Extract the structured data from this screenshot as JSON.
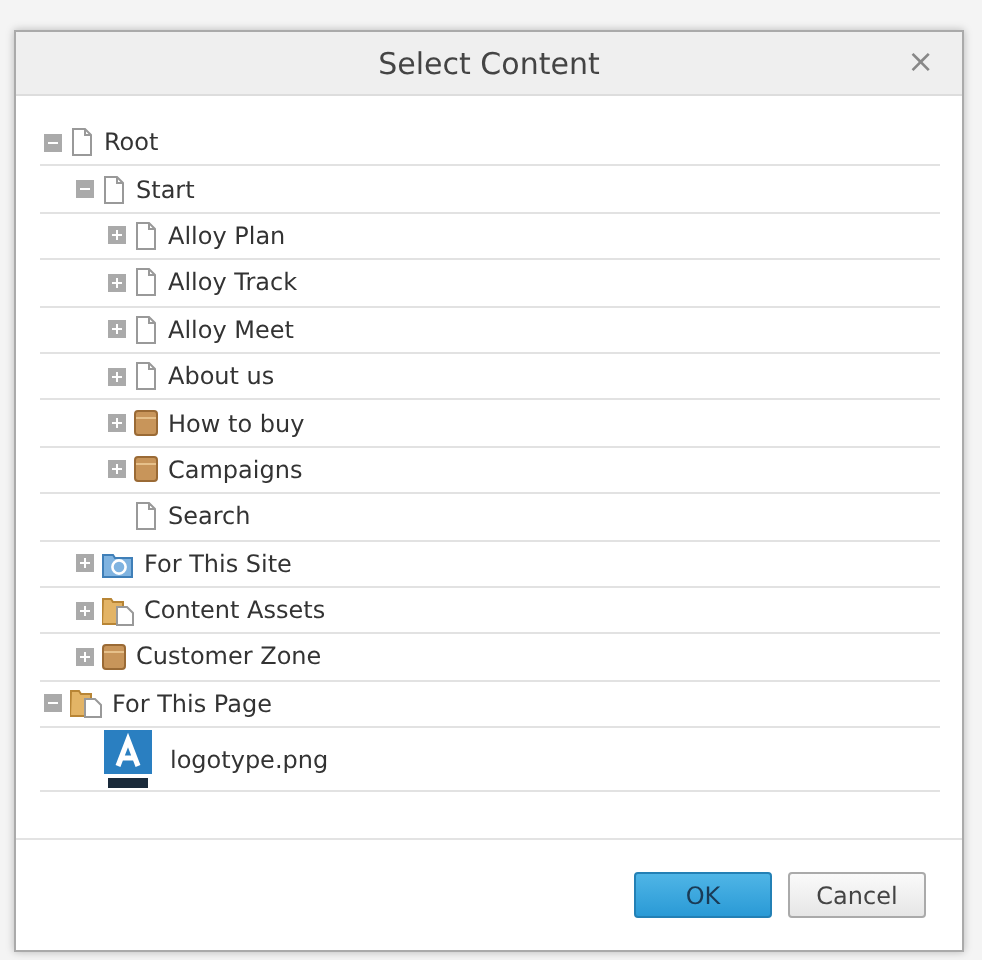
{
  "dialog": {
    "title": "Select Content",
    "close": "×"
  },
  "tree": [
    {
      "label": "Root",
      "kind": "page",
      "expanded": true,
      "children": [
        {
          "label": "Start",
          "kind": "page",
          "expanded": true,
          "children": [
            {
              "label": "Alloy Plan",
              "kind": "page",
              "expanded": false
            },
            {
              "label": "Alloy Track",
              "kind": "page",
              "expanded": false
            },
            {
              "label": "Alloy Meet",
              "kind": "page",
              "expanded": false
            },
            {
              "label": "About us",
              "kind": "page",
              "expanded": false
            },
            {
              "label": "How to buy",
              "kind": "box",
              "expanded": false
            },
            {
              "label": "Campaigns",
              "kind": "box",
              "expanded": false
            },
            {
              "label": "Search",
              "kind": "page"
            }
          ]
        },
        {
          "label": "For This Site",
          "kind": "site",
          "expanded": false
        },
        {
          "label": "Content Assets",
          "kind": "assets",
          "expanded": false
        },
        {
          "label": "Customer Zone",
          "kind": "box",
          "expanded": false
        }
      ]
    },
    {
      "label": "For This Page",
      "kind": "assets",
      "expanded": true,
      "children": [
        {
          "label": "logotype.png",
          "kind": "image"
        }
      ]
    }
  ],
  "buttons": [
    {
      "label": "OK",
      "kind": "primary"
    },
    {
      "label": "Cancel",
      "kind": "secondary"
    }
  ]
}
